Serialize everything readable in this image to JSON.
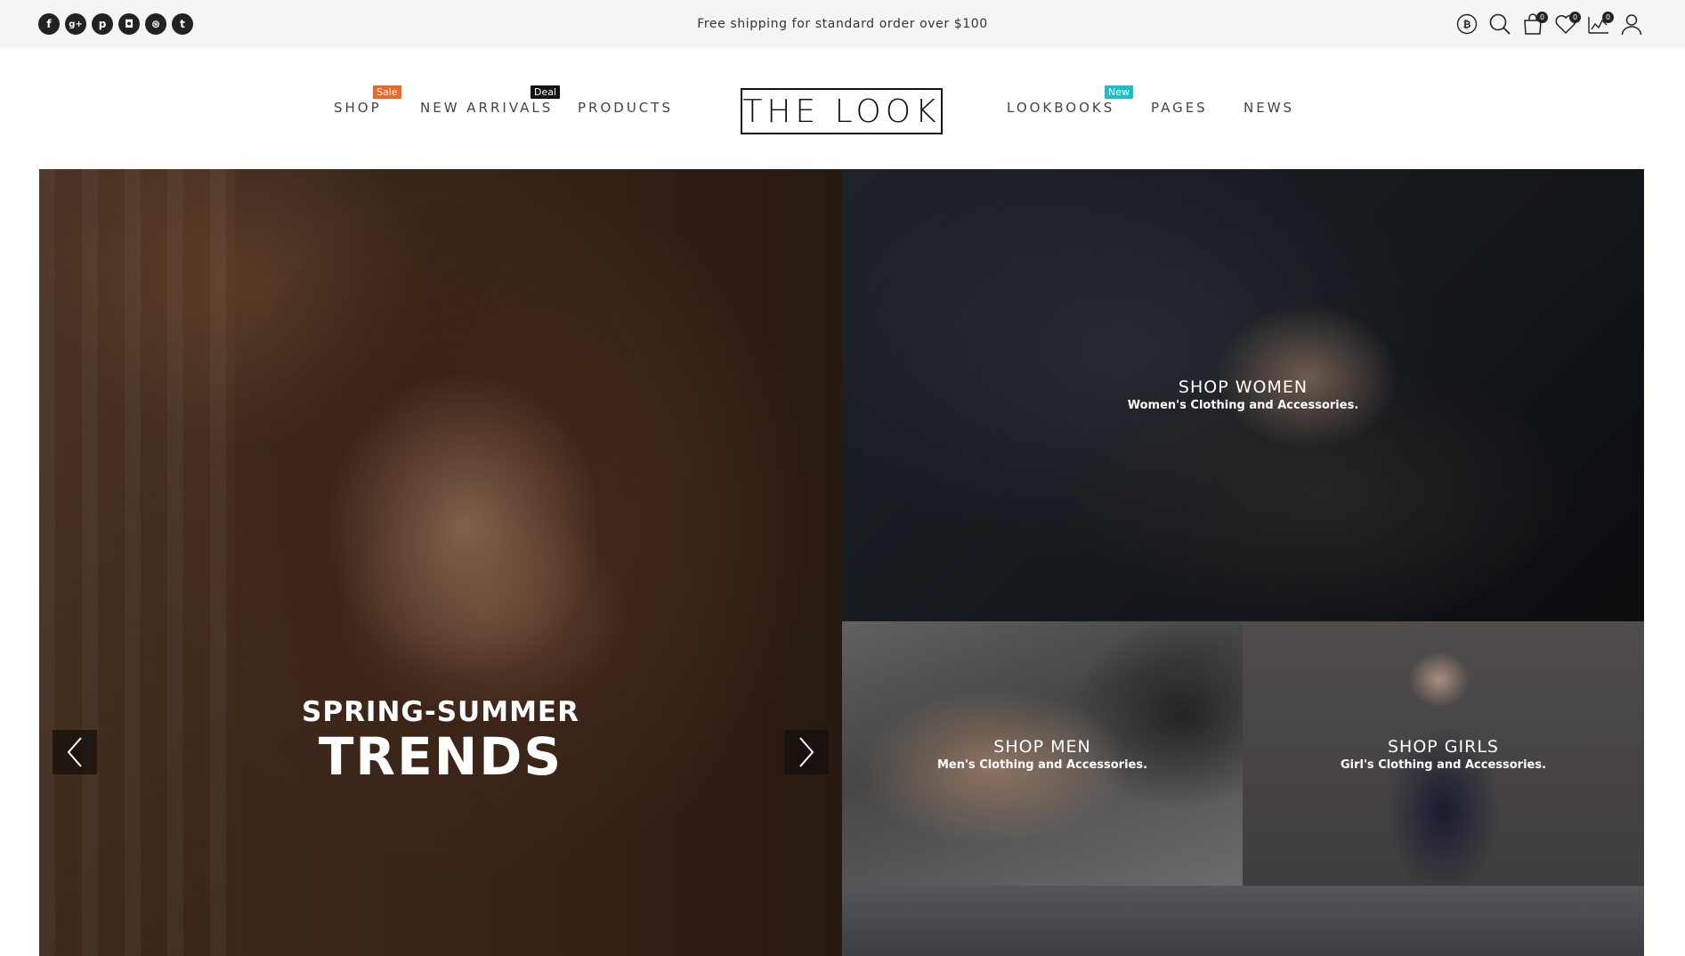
{
  "topbar": {
    "social": [
      {
        "icon": "facebook-icon",
        "glyph": "f"
      },
      {
        "icon": "google-plus-icon",
        "glyph": "g+"
      },
      {
        "icon": "pinterest-icon",
        "glyph": "p"
      },
      {
        "icon": "instagram-icon",
        "glyph": "◘"
      },
      {
        "icon": "dribbble-icon",
        "glyph": "⊛"
      },
      {
        "icon": "tumblr-icon",
        "glyph": "t"
      }
    ],
    "promo": "Free shipping for standard order over $100",
    "utility": {
      "currency_icon": "bitcoin-icon",
      "search_icon": "search-icon",
      "cart_icon": "shopping-bag-icon",
      "cart_count": "0",
      "wishlist_icon": "heart-icon",
      "wishlist_count": "0",
      "compare_icon": "compare-chart-icon",
      "compare_count": "0",
      "account_icon": "user-icon"
    }
  },
  "nav": {
    "shop": "SHOP",
    "shop_badge": "Sale",
    "new_arrivals": "NEW ARRIVALS",
    "new_arrivals_badge": "Deal",
    "products": "PRODUCTS",
    "logo": "THE LOOK",
    "lookbooks": "LOOKBOOKS",
    "lookbooks_badge": "New",
    "pages": "PAGES",
    "news": "NEWS"
  },
  "hero": {
    "line1": "SPRING-SUMMER",
    "line2": "TRENDS",
    "prev_icon": "chevron-left-icon",
    "next_icon": "chevron-right-icon"
  },
  "categories": {
    "women": {
      "title": "SHOP WOMEN",
      "subtitle": "Women's Clothing and Accessories."
    },
    "men": {
      "title": "SHOP MEN",
      "subtitle": "Men's Clothing and Accessories."
    },
    "girls": {
      "title": "SHOP GIRLS",
      "subtitle": "Girl's Clothing and Accessories."
    }
  },
  "colors": {
    "badge_sale": "#f26522",
    "badge_deal": "#111111",
    "badge_new": "#1bbfc9",
    "topbar_bg": "#f5f5f5"
  }
}
